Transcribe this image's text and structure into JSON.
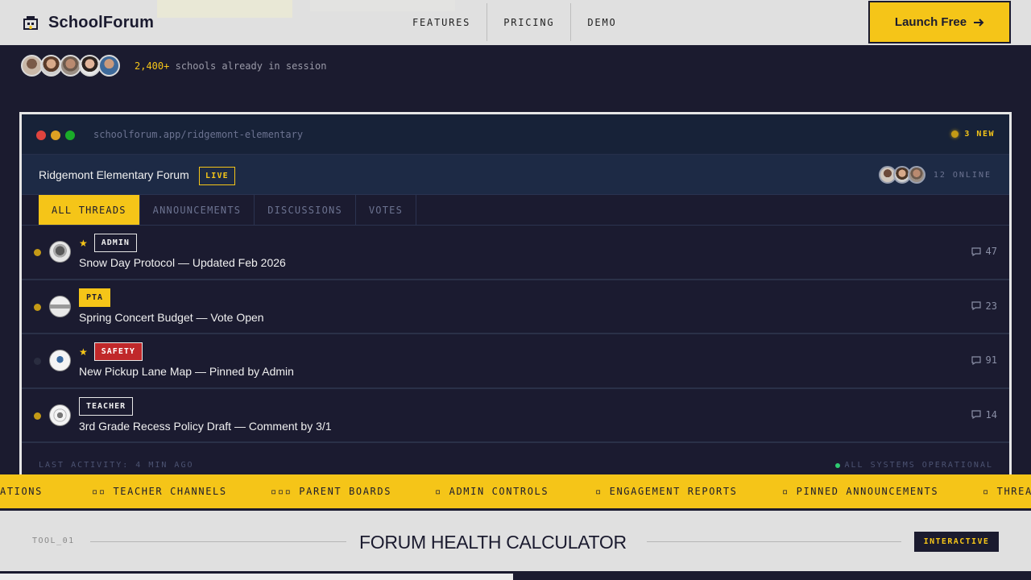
{
  "nav": {
    "brand": "SchoolForum",
    "links": [
      "FEATURES",
      "PRICING",
      "DEMO"
    ],
    "cta": "Launch Free"
  },
  "proof": {
    "count": "2,400+",
    "text": "schools already in session"
  },
  "window": {
    "url": "schoolforum.app/ridgemont-elementary",
    "new_badge": "3 NEW",
    "forum_title": "Ridgemont Elementary Forum",
    "live": "LIVE",
    "online": "12 ONLINE",
    "tabs": [
      "ALL THREADS",
      "ANNOUNCEMENTS",
      "DISCUSSIONS",
      "VOTES"
    ],
    "threads": [
      {
        "tag": "ADMIN",
        "title": "Snow Day Protocol — Updated Feb 2026",
        "count": "47"
      },
      {
        "tag": "PTA",
        "title": "Spring Concert Budget — Vote Open",
        "count": "23"
      },
      {
        "tag": "SAFETY",
        "title": "New Pickup Lane Map — Pinned by Admin",
        "count": "91"
      },
      {
        "tag": "TEACHER",
        "title": "3rd Grade Recess Policy Draft — Comment by 3/1",
        "count": "14"
      }
    ],
    "last_activity": "LAST ACTIVITY: 4 MIN AGO",
    "status": "ALL SYSTEMS OPERATIONAL"
  },
  "marquee": {
    "items": [
      "ATIONS",
      "▫▫ TEACHER CHANNELS",
      "▫▫▫ PARENT BOARDS",
      "▫ ADMIN CONTROLS",
      "▫ ENGAGEMENT REPORTS",
      "▫ PINNED ANNOUNCEMENTS",
      "▫ THREA"
    ]
  },
  "tool": {
    "label": "TOOL_01",
    "title": "FORUM HEALTH CALCULATOR",
    "badge": "INTERACTIVE"
  },
  "colors": {
    "accent": "#f5c518",
    "background": "#1b1b2f",
    "danger": "#c0282a",
    "online": "#2ecc71"
  }
}
